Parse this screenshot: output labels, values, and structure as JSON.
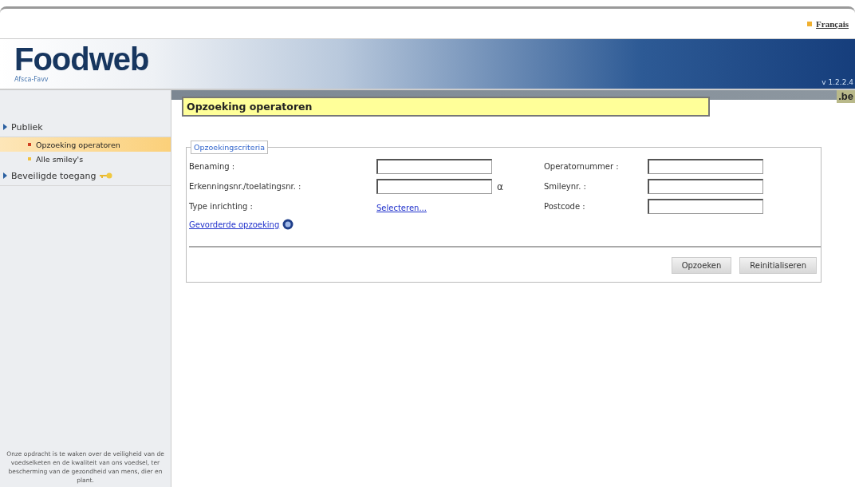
{
  "header": {
    "language_link": "Français",
    "logo": "Foodweb",
    "logo_subtitle": "Afsca-Favv",
    "version": "v 1.2.2.4",
    "badge": ".be"
  },
  "sidebar": {
    "sections": [
      {
        "label": "Publiek",
        "items": [
          {
            "label": "Opzoeking operatoren",
            "selected": true
          },
          {
            "label": "Alle smiley's",
            "selected": false
          }
        ]
      },
      {
        "label": "Beveiligde toegang",
        "secured": true
      }
    ],
    "mission": "Onze opdracht is te waken over de veiligheid van de voedselketen en de kwaliteit van ons voedsel, ter bescherming van de gezondheid van mens, dier en plant."
  },
  "page_title": "Opzoeking operatoren",
  "criteria": {
    "legend": "Opzoekingscriteria",
    "left_fields": [
      {
        "label": "Benaming :",
        "kind": "input"
      },
      {
        "label": "Erkenningsnr./toelatingsnr. :",
        "kind": "input",
        "suffix": "α"
      },
      {
        "label": "Type inrichting :",
        "kind": "link",
        "link": "Selecteren..."
      }
    ],
    "right_fields": [
      {
        "label": "Operatornummer :",
        "kind": "input"
      },
      {
        "label": "Smileynr. :",
        "kind": "input"
      },
      {
        "label": "Postcode :",
        "kind": "input"
      }
    ],
    "advanced_link": "Gevorderde opzoeking",
    "buttons": [
      "Opzoeken",
      "Reinitialiseren"
    ]
  }
}
